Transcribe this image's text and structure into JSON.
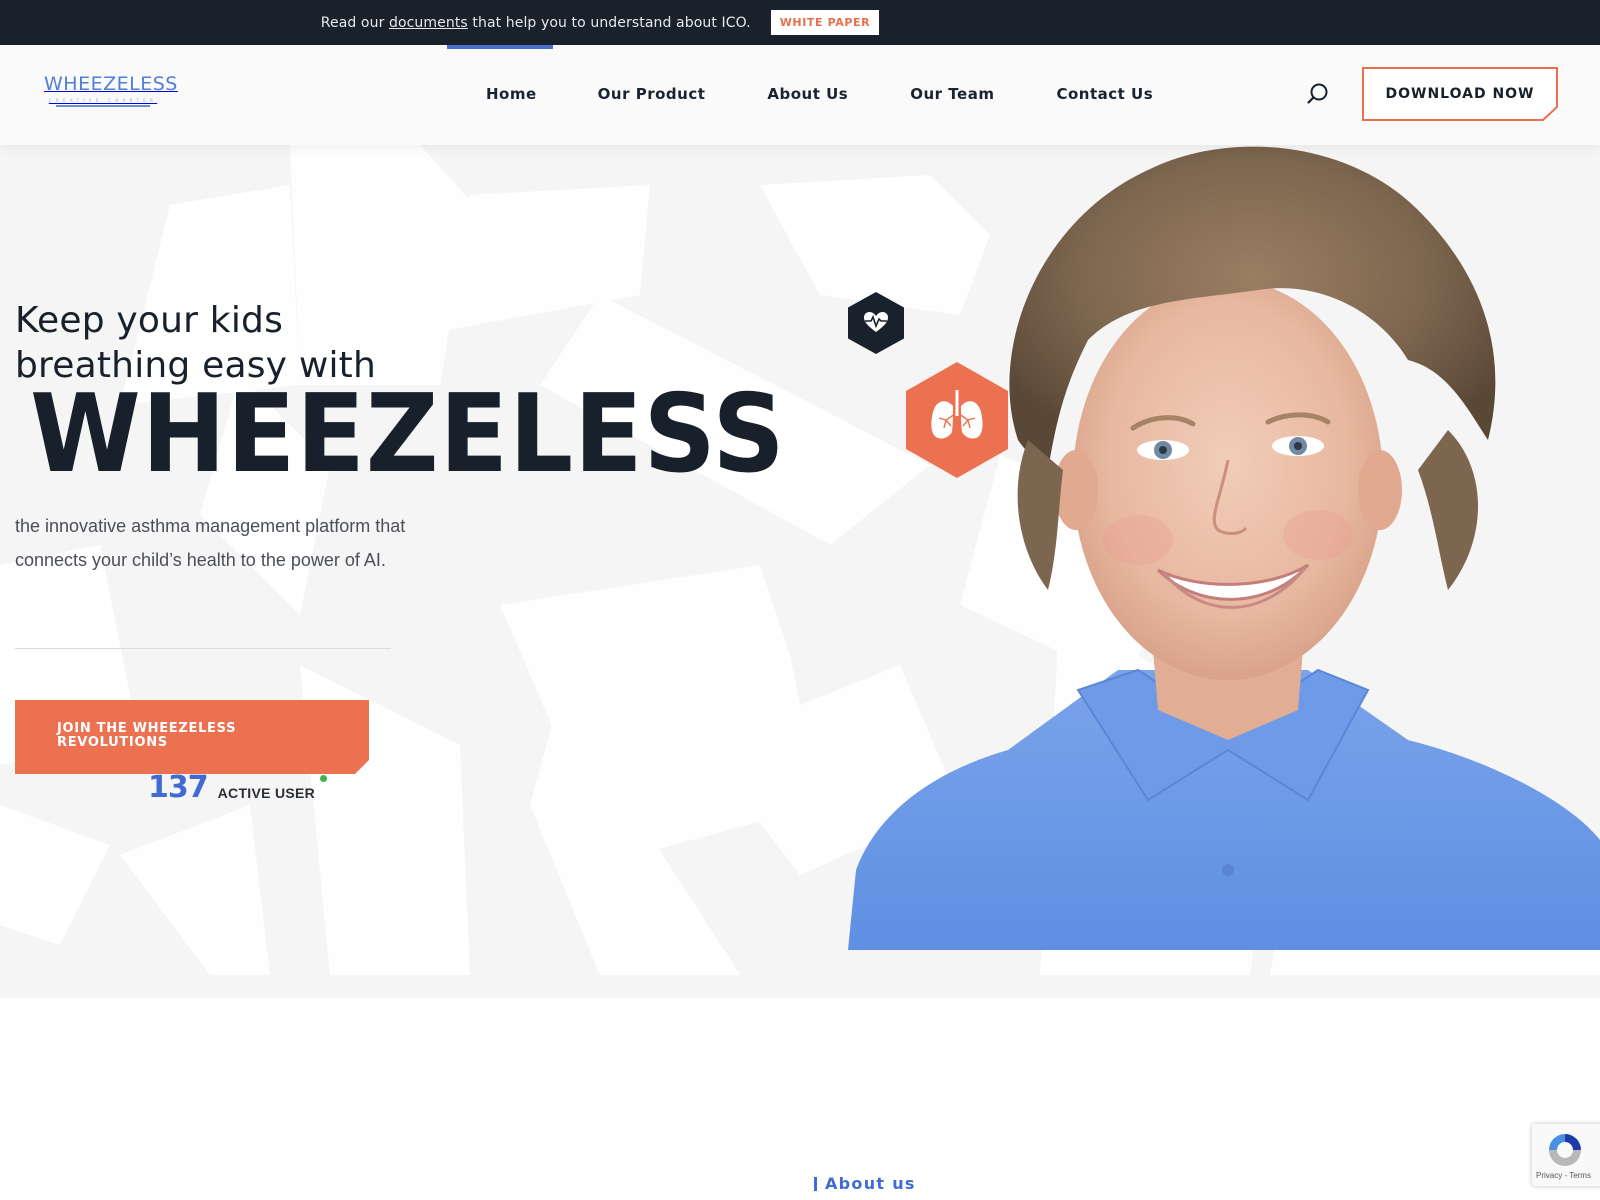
{
  "topbar": {
    "text_before": "Read our ",
    "link": "documents",
    "text_after": " that help you to understand about ICO.",
    "button": "WHITE PAPER"
  },
  "header": {
    "logo": {
      "wordmark": "WHEEZELESS",
      "tagline": "CREATIVE CHARTER"
    },
    "nav": [
      {
        "label": "Home",
        "active": true
      },
      {
        "label": "Our Product",
        "active": false
      },
      {
        "label": "About Us",
        "active": false
      },
      {
        "label": "Our Team",
        "active": false
      },
      {
        "label": "Contact Us",
        "active": false
      }
    ],
    "search_icon": "search-icon",
    "cta": "DOWNLOAD NOW"
  },
  "hero": {
    "heading_line1": "Keep your kids",
    "heading_line2": "breathing easy with",
    "brand": "WHEEZELESS",
    "description": "the innovative asthma management platform that connects your child’s health to the power of AI.",
    "cta": "JOIN THE WHEEZELESS REVOLUTIONS",
    "active_users": {
      "count": "137",
      "label": "ACTIVE USER",
      "status": "online"
    },
    "icons": [
      "heart-pulse-icon",
      "lungs-icon"
    ],
    "image": "smiling-boy-photo"
  },
  "about": {
    "label": "About us"
  },
  "recaptcha": {
    "links": "Privacy - Terms"
  },
  "colors": {
    "dark": "#19212c",
    "accent_orange": "#ec7150",
    "accent_blue": "#3f6bd2",
    "online_green": "#3db54a",
    "hero_bg": "#f5f5f5"
  }
}
